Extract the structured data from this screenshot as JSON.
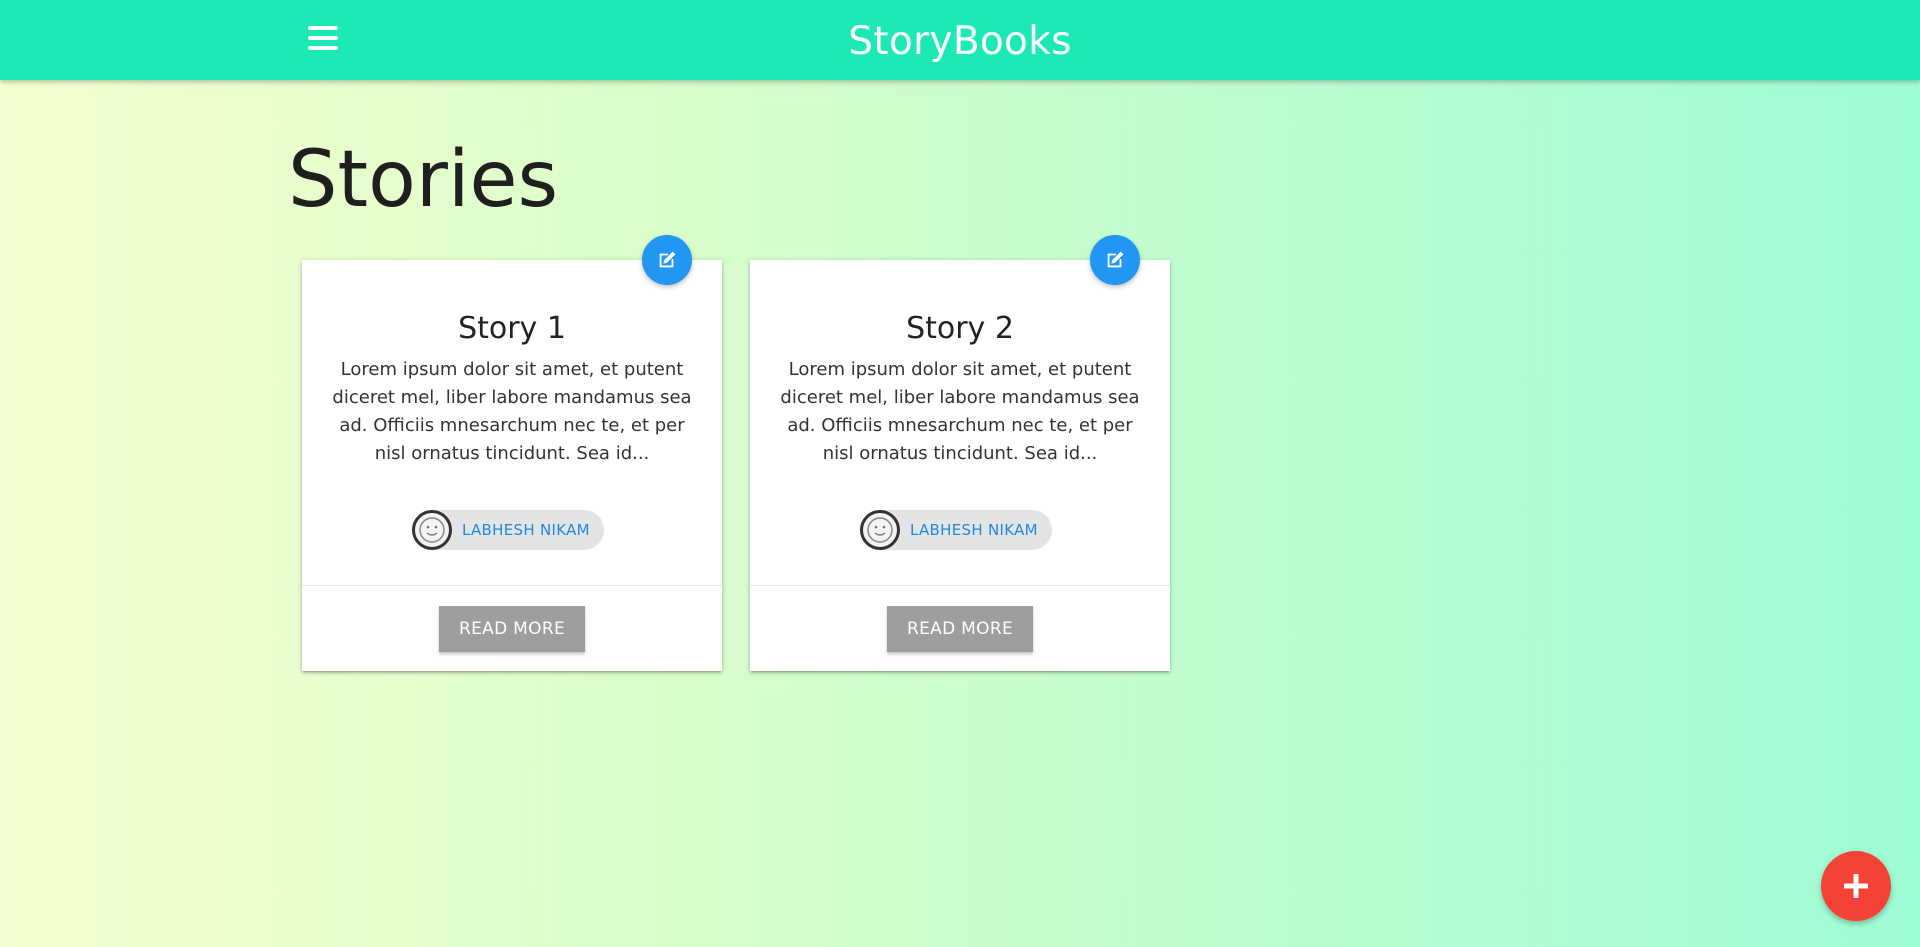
{
  "navbar": {
    "brand": "StoryBooks",
    "menu_icon": "hamburger-menu-icon"
  },
  "page": {
    "title": "Stories"
  },
  "stories": [
    {
      "title": "Story 1",
      "excerpt": "Lorem ipsum dolor sit amet, et putent diceret mel, liber labore mandamus sea ad. Officiis mnesarchum nec te, et per nisl ornatus tincidunt. Sea id...",
      "author": "LABHESH NIKAM",
      "button": "READ MORE",
      "edit_icon": "edit-icon"
    },
    {
      "title": "Story 2",
      "excerpt": "Lorem ipsum dolor sit amet, et putent diceret mel, liber labore mandamus sea ad. Officiis mnesarchum nec te, et per nisl ornatus tincidunt. Sea id...",
      "author": "LABHESH NIKAM",
      "button": "READ MORE",
      "edit_icon": "edit-icon"
    }
  ],
  "fab": {
    "icon": "plus-icon"
  },
  "colors": {
    "navbar": "#1de9b6",
    "edit_fab": "#2196f3",
    "add_fab": "#f44336",
    "author_link": "#1e88e5",
    "read_more_button": "#9e9e9e"
  }
}
